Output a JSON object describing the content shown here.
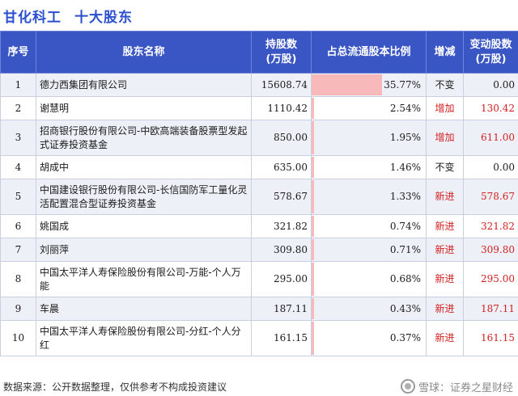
{
  "header": {
    "company": "甘化科工",
    "title": "十大股东"
  },
  "table": {
    "columns": [
      "序号",
      "股东名称",
      "持股数\n(万股)",
      "占总流通股本比例",
      "增减",
      "变动股数\n(万股)"
    ],
    "rows": [
      {
        "idx": "1",
        "name": "德力西集团有限公司",
        "shares": "15608.74",
        "pct": "35.77%",
        "pct_value": 35.77,
        "change": "不变",
        "delta": "0.00",
        "highlight": false
      },
      {
        "idx": "2",
        "name": "谢慧明",
        "shares": "1110.42",
        "pct": "2.54%",
        "pct_value": 2.54,
        "change": "增加",
        "delta": "130.42",
        "highlight": true
      },
      {
        "idx": "3",
        "name": "招商银行股份有限公司-中欧高端装备股票型发起式证券投资基金",
        "shares": "850.00",
        "pct": "1.95%",
        "pct_value": 1.95,
        "change": "增加",
        "delta": "611.00",
        "highlight": true
      },
      {
        "idx": "4",
        "name": "胡成中",
        "shares": "635.00",
        "pct": "1.46%",
        "pct_value": 1.46,
        "change": "不变",
        "delta": "0.00",
        "highlight": false
      },
      {
        "idx": "5",
        "name": "中国建设银行股份有限公司-长信国防军工量化灵活配置混合型证券投资基金",
        "shares": "578.67",
        "pct": "1.33%",
        "pct_value": 1.33,
        "change": "新进",
        "delta": "578.67",
        "highlight": true
      },
      {
        "idx": "6",
        "name": "姚国成",
        "shares": "321.82",
        "pct": "0.74%",
        "pct_value": 0.74,
        "change": "新进",
        "delta": "321.82",
        "highlight": true
      },
      {
        "idx": "7",
        "name": "刘丽萍",
        "shares": "309.80",
        "pct": "0.71%",
        "pct_value": 0.71,
        "change": "新进",
        "delta": "309.80",
        "highlight": true
      },
      {
        "idx": "8",
        "name": "中国太平洋人寿保险股份有限公司-万能-个人万能",
        "shares": "295.00",
        "pct": "0.68%",
        "pct_value": 0.68,
        "change": "新进",
        "delta": "295.00",
        "highlight": true
      },
      {
        "idx": "9",
        "name": "车晨",
        "shares": "187.11",
        "pct": "0.43%",
        "pct_value": 0.43,
        "change": "新进",
        "delta": "187.11",
        "highlight": true
      },
      {
        "idx": "10",
        "name": "中国太平洋人寿保险股份有限公司-分红-个人分红",
        "shares": "161.15",
        "pct": "0.37%",
        "pct_value": 0.37,
        "change": "新进",
        "delta": "161.15",
        "highlight": true
      }
    ]
  },
  "footer": {
    "source": "数据来源：公开数据整理，仅供参考不构成投资建议",
    "brand": "雪球：证券之星财经"
  },
  "colors": {
    "header_bg": "#3a55c4",
    "title": "#2b4fcf",
    "bar": "#f7b9b9",
    "highlight_text": "#d42020"
  }
}
